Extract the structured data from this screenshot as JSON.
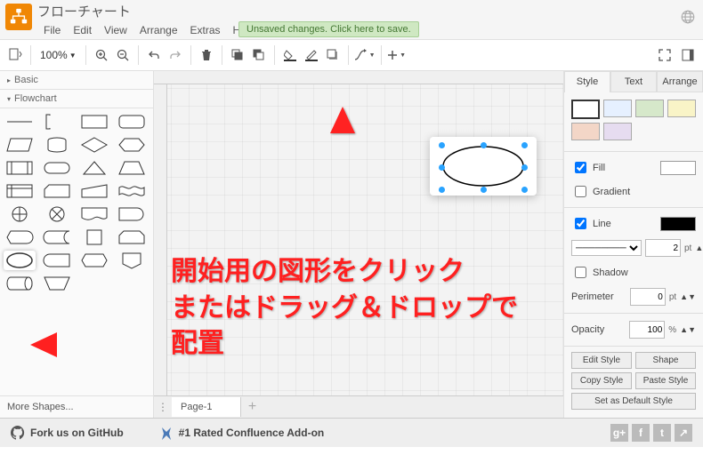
{
  "title": "フローチャート",
  "menu": {
    "file": "File",
    "edit": "Edit",
    "view": "View",
    "arrange": "Arrange",
    "extras": "Extras",
    "help": "Help"
  },
  "save_msg": "Unsaved changes. Click here to save.",
  "toolbar": {
    "zoom": "100%"
  },
  "palette": {
    "basic": "Basic",
    "flowchart": "Flowchart",
    "more": "More Shapes..."
  },
  "page": {
    "tab": "Page-1"
  },
  "style": {
    "tabs": {
      "style": "Style",
      "text": "Text",
      "arrange": "Arrange"
    },
    "swatches": [
      "#ffffff",
      "#e6f0ff",
      "#d6e8ca",
      "#f9f4c7",
      "#f3d6c7",
      "#e6dcf0"
    ],
    "fill": "Fill",
    "gradient": "Gradient",
    "line": "Line",
    "line_width": "2",
    "line_unit": "pt",
    "shadow": "Shadow",
    "perimeter": "Perimeter",
    "perimeter_val": "0",
    "perimeter_unit": "pt",
    "opacity": "Opacity",
    "opacity_val": "100",
    "opacity_unit": "%",
    "btn1": "Edit Style",
    "btn2": "Shape",
    "btn3": "Copy Style",
    "btn4": "Paste Style",
    "btn5": "Set as Default Style"
  },
  "footer": {
    "github": "Fork us on GitHub",
    "confluence": "#1 Rated Confluence Add-on"
  },
  "annotation": {
    "line1": "開始用の図形をクリック",
    "line2": "またはドラッグ＆ドロップで",
    "line3": "配置"
  }
}
